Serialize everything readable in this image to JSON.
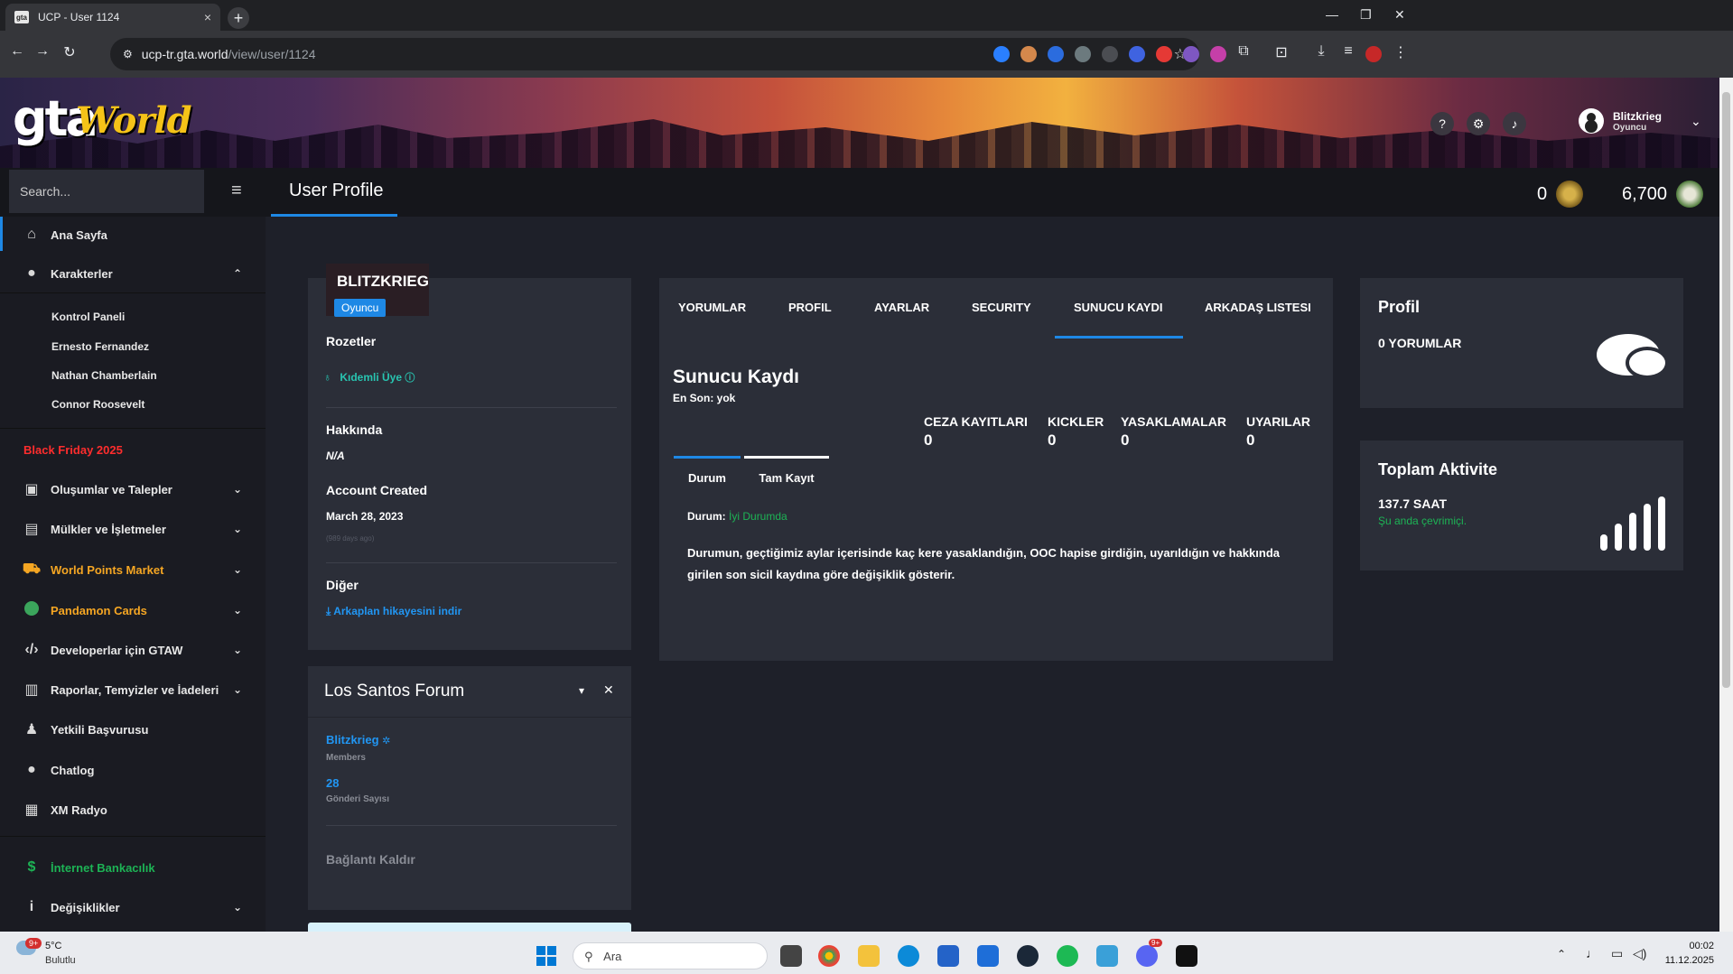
{
  "browser": {
    "tab_title": "UCP - User 1124",
    "tab_close": "×",
    "new_tab": "+",
    "url_host": "ucp-tr.gta.world",
    "url_path": "/view/user/1124"
  },
  "header": {
    "logo_gta": "gta",
    "logo_world": "World",
    "user_name": "Blitzkrieg",
    "user_role": "Oyuncu"
  },
  "topbar": {
    "search_placeholder": "Search...",
    "page_title": "User Profile",
    "coin_count": "0",
    "points_count": "6,700"
  },
  "sidebar": {
    "home": "Ana Sayfa",
    "characters": "Karakterler",
    "sub": [
      "Kontrol Paneli",
      "Ernesto Fernandez",
      "Nathan Chamberlain",
      "Connor Roosevelt"
    ],
    "black_friday": "Black Friday 2025",
    "items": [
      {
        "label": "Oluşumlar ve Talepler",
        "icon": "briefcase-icon"
      },
      {
        "label": "Mülkler ve İşletmeler",
        "icon": "building-icon"
      },
      {
        "label": "World Points Market",
        "icon": "cart-icon"
      },
      {
        "label": "Pandamon Cards",
        "icon": "pandamon-icon"
      },
      {
        "label": "Developerlar için GTAW",
        "icon": "code-icon"
      },
      {
        "label": "Raporlar, Temyizler ve İadeleri",
        "icon": "report-icon"
      },
      {
        "label": "Yetkili Başvurusu",
        "icon": "user-tie-icon"
      },
      {
        "label": "Chatlog",
        "icon": "chat-icon"
      },
      {
        "label": "XM Radyo",
        "icon": "radio-icon"
      },
      {
        "label": "İnternet Bankacılık",
        "icon": "dollar-icon"
      },
      {
        "label": "Değişiklikler",
        "icon": "info-icon"
      }
    ]
  },
  "profile": {
    "name": "BLITZKRIEG",
    "role_badge": "Oyuncu",
    "badges_title": "Rozetler",
    "badge_name": "Kıdemli Üye",
    "about_title": "Hakkında",
    "about_value": "N/A",
    "created_title": "Account Created",
    "created_value": "March 28, 2023",
    "created_ago": "(989 days ago)",
    "other_title": "Diğer",
    "download_link": "Arkaplan hikayesini indir"
  },
  "forum": {
    "title": "Los Santos Forum",
    "username": "Blitzkrieg",
    "group": "Members",
    "post_count": "28",
    "post_label": "Gönderi Sayısı",
    "disconnect": "Bağlantı Kaldır"
  },
  "tabs": [
    "YORUMLAR",
    "PROFIL",
    "AYARLAR",
    "SECURITY",
    "SUNUCU KAYDI",
    "ARKADAŞ LISTESI"
  ],
  "record": {
    "title": "Sunucu Kaydı",
    "last": "En Son: yok",
    "stats": [
      {
        "label": "CEZA KAYITLARI",
        "value": "0"
      },
      {
        "label": "KICKLER",
        "value": "0"
      },
      {
        "label": "YASAKLAMALAR",
        "value": "0"
      },
      {
        "label": "UYARILAR",
        "value": "0"
      }
    ],
    "subtabs": [
      "Durum",
      "Tam Kayıt"
    ],
    "status_label": "Durum:",
    "status_value": "İyi Durumda",
    "description": "Durumun, geçtiğimiz aylar içerisinde kaç kere yasaklandığın, OOC hapise girdiğin, uyarıldığın ve hakkında girilen son sicil kaydına göre değişiklik gösterir."
  },
  "right": {
    "profile_title": "Profil",
    "comments": "0 YORUMLAR",
    "activity_title": "Toplam Aktivite",
    "hours": "137.7 SAAT",
    "online": "Şu anda çevrimiçi."
  },
  "taskbar": {
    "temp": "5°C",
    "weather": "Bulutlu",
    "weather_badge": "9+",
    "search": "Ara",
    "discord_badge": "9+",
    "time": "00:02",
    "date": "11.12.2025"
  },
  "colors": {
    "accent": "#1e88e5",
    "card": "#2b2e38",
    "page": "#1e2029",
    "green": "#1db355",
    "red": "#ff2d2d",
    "gold": "#f5a623"
  }
}
